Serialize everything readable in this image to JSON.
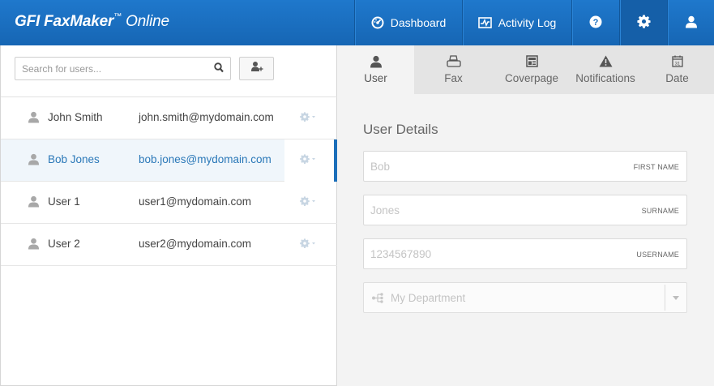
{
  "app": {
    "logo_prefix": "GFI FaxMaker",
    "logo_tm": "™",
    "logo_suffix": " Online"
  },
  "nav": {
    "dashboard_label": "Dashboard",
    "activity_label": "Activity Log",
    "icons": [
      "dashboard-icon",
      "activity-icon",
      "help-icon",
      "gear-icon",
      "user-icon"
    ]
  },
  "search": {
    "placeholder": "Search for users..."
  },
  "users": [
    {
      "name": "John Smith",
      "email": "john.smith@mydomain.com"
    },
    {
      "name": "Bob Jones",
      "email": "bob.jones@mydomain.com"
    },
    {
      "name": "User 1",
      "email": "user1@mydomain.com"
    },
    {
      "name": "User 2",
      "email": "user2@mydomain.com"
    }
  ],
  "selected_user_index": 1,
  "tabs": [
    {
      "label": "User",
      "icon": "user-icon"
    },
    {
      "label": "Fax",
      "icon": "fax-icon"
    },
    {
      "label": "Coverpage",
      "icon": "coverpage-icon"
    },
    {
      "label": "Notifications",
      "icon": "warning-icon"
    },
    {
      "label": "Date",
      "icon": "calendar-icon"
    }
  ],
  "active_tab": "User",
  "details": {
    "title": "User Details",
    "first_name": {
      "value": "Bob",
      "label": "FIRST NAME"
    },
    "surname": {
      "value": "Jones",
      "label": "SURNAME"
    },
    "username": {
      "value": "1234567890",
      "label": "USERNAME"
    },
    "department": {
      "value": "My Department"
    }
  },
  "colors": {
    "topbar": "#1b6fc0",
    "selected_text": "#2a78b8",
    "selected_bar": "#1c6fba"
  }
}
